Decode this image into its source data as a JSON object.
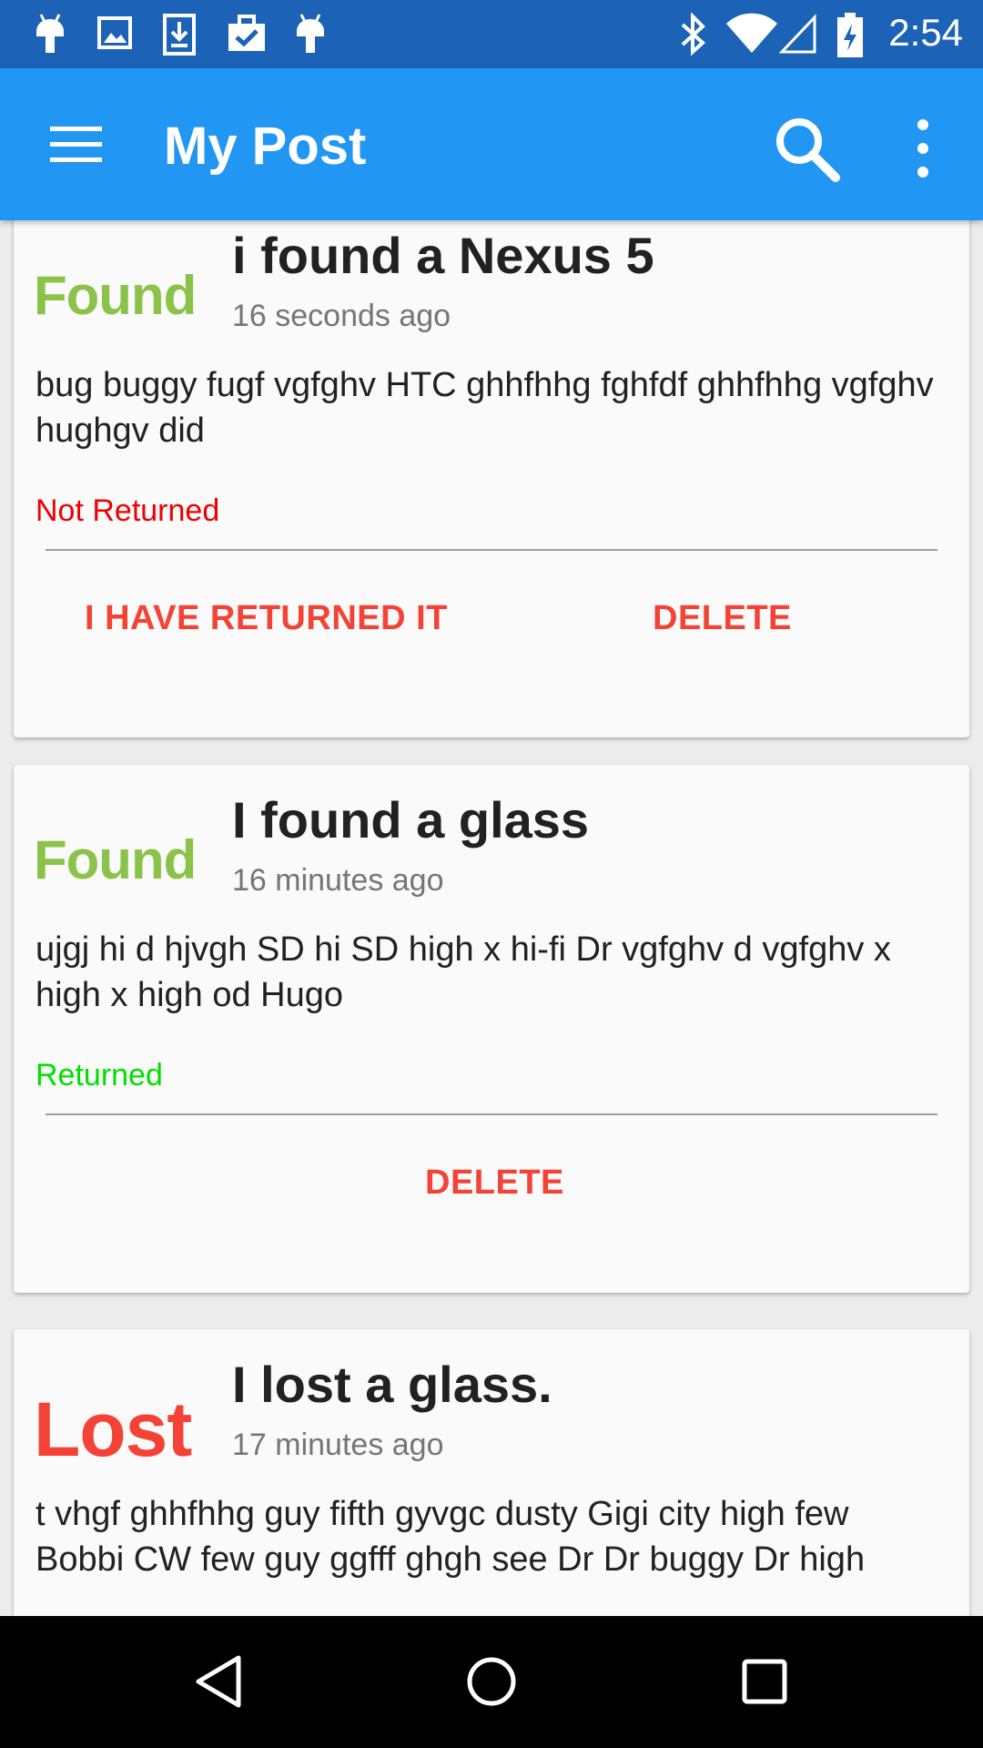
{
  "status_bar": {
    "time": "2:54",
    "left_icons": [
      "android-icon",
      "image-icon",
      "download-icon",
      "clipboard-check-icon",
      "android-icon"
    ],
    "right_icons": [
      "bluetooth-icon",
      "wifi-icon",
      "cell-signal-icon",
      "battery-charging-icon"
    ]
  },
  "app_bar": {
    "title": "My Post",
    "background": "#2196f3"
  },
  "posts": [
    {
      "badge": "Found",
      "badge_color": "#8bc34a",
      "title": "i found a Nexus 5",
      "time": "16 seconds ago",
      "body": "bug buggy fugf vgfghv HTC ghhfhhg fghfdf ghhfhhg vgfghv hughgv did",
      "status": "Not Returned",
      "status_color": "#f00000",
      "actions": [
        "I HAVE RETURNED IT",
        "DELETE"
      ]
    },
    {
      "badge": "Found",
      "badge_color": "#8bc34a",
      "title": "I found a glass",
      "time": "16 minutes ago",
      "body": "ujgj hi d hjvgh SD hi SD high x hi-fi Dr vgfghv d vgfghv x high x high od Hugo",
      "status": "Returned",
      "status_color": "#00e000",
      "actions": [
        "DELETE"
      ]
    },
    {
      "badge": "Lost",
      "badge_color": "#f44336",
      "title": "I lost a glass.",
      "time": "17 minutes ago",
      "body": "t vhgf ghhfhhg guy fifth gyvgc dusty Gigi city high few Bobbi CW few guy ggfff ghgh see Dr Dr buggy Dr high"
    }
  ],
  "nav_bar": {
    "buttons": [
      "back-icon",
      "home-icon",
      "recents-icon"
    ]
  }
}
